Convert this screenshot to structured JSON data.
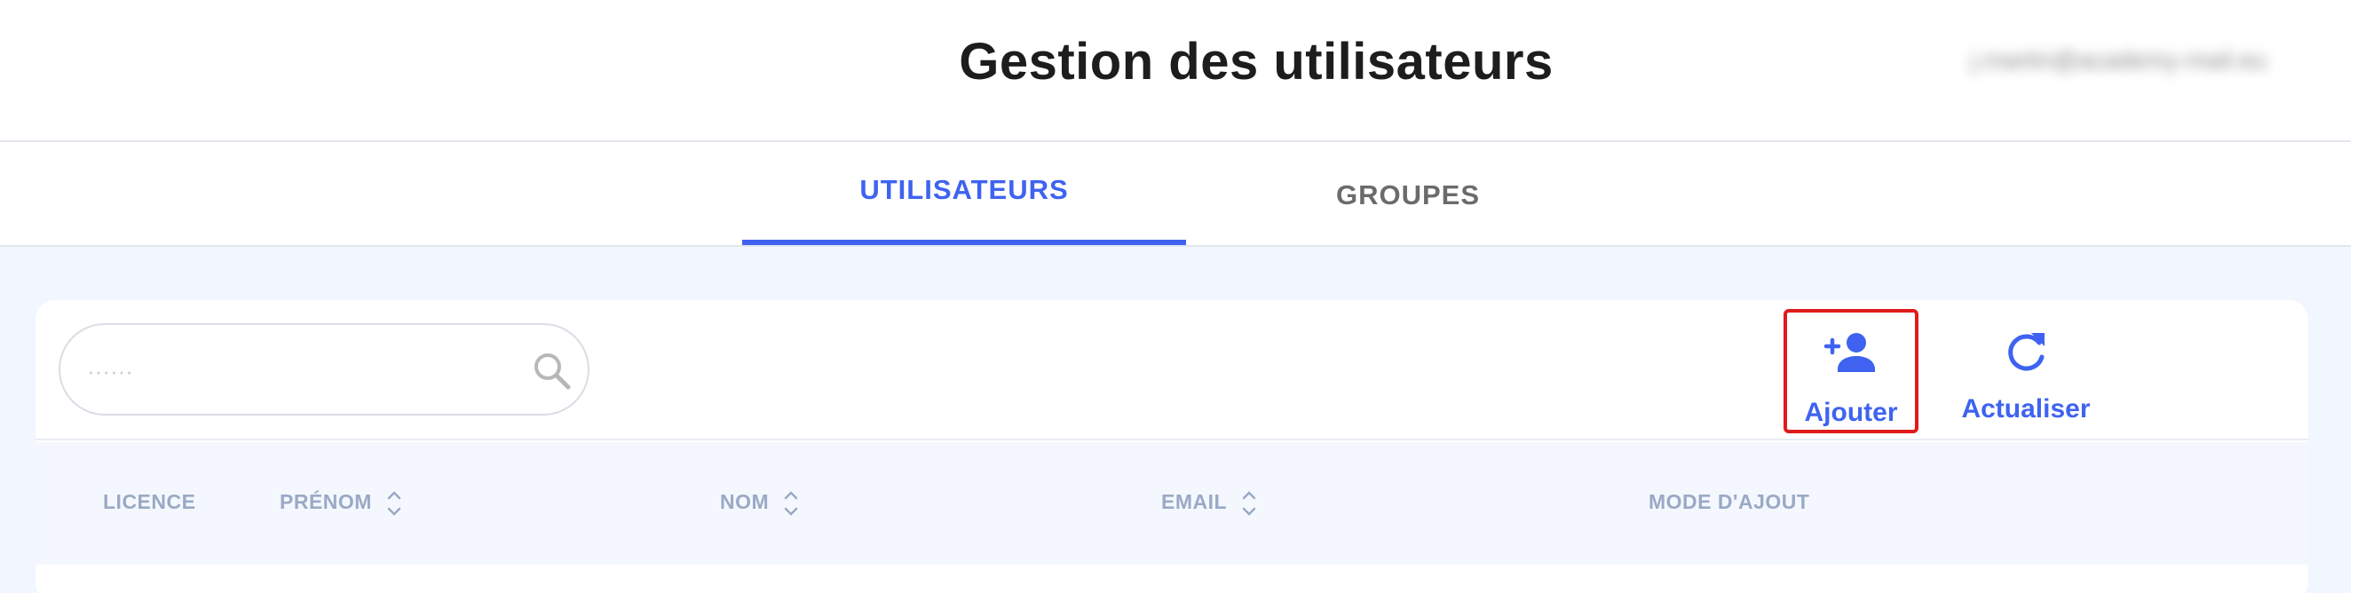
{
  "header": {
    "title": "Gestion des utilisateurs",
    "user_email": "j.martin@academy-mail.eu"
  },
  "tabs": [
    {
      "label": "UTILISATEURS",
      "active": true
    },
    {
      "label": "GROUPES",
      "active": false
    }
  ],
  "toolbar": {
    "search": {
      "value": "",
      "placeholder": "······"
    },
    "add_label": "Ajouter",
    "refresh_label": "Actualiser"
  },
  "table": {
    "columns": [
      {
        "label": "LICENCE",
        "sortable": false
      },
      {
        "label": "PRÉNOM",
        "sortable": true
      },
      {
        "label": "NOM",
        "sortable": true
      },
      {
        "label": "EMAIL",
        "sortable": true
      },
      {
        "label": "MODE D'AJOUT",
        "sortable": false
      }
    ]
  },
  "colors": {
    "accent": "#3f63f0",
    "title": "#1d1d1f",
    "inactive_tab": "#6b6b6b",
    "column_header": "#9aa9c5",
    "content_background": "#f2f6fe",
    "highlight_border": "#e01b1b"
  },
  "icons": {
    "search": "search-icon",
    "add_user": "add-user-icon",
    "refresh": "refresh-icon",
    "sort": "sort-icon"
  }
}
